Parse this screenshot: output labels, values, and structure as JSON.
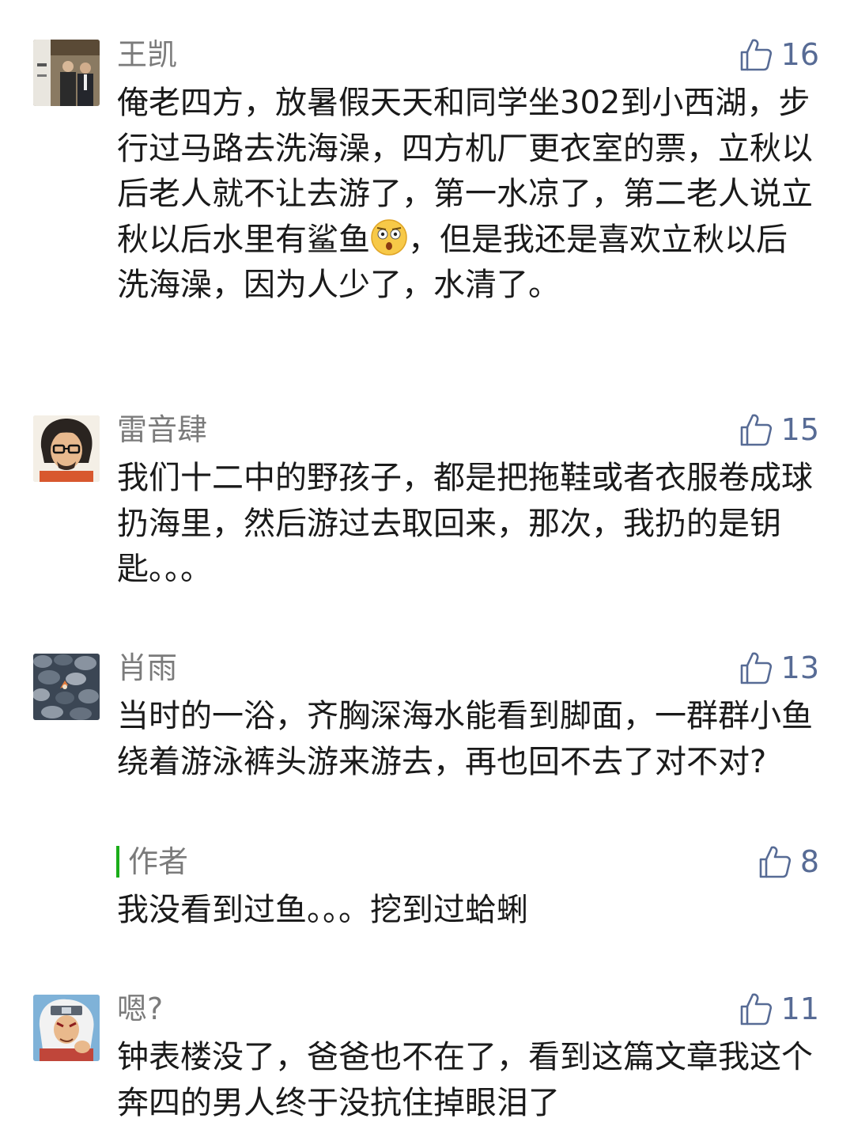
{
  "comments": [
    {
      "name": "王凯",
      "likes": "16",
      "text_before_emoji": "俺老四方，放暑假天天和同学坐302到小西湖，步行过马路去洗海澡，四方机厂更衣室的票，立秋以后老人就不让去游了，第一水凉了，第二老人说立秋以后水里有鲨鱼",
      "emoji": "shocked-face-emoji",
      "text_after_emoji": "，但是我还是喜欢立秋以后洗海澡，因为人少了，水清了。"
    },
    {
      "name": "雷音肆",
      "likes": "15",
      "text": "我们十二中的野孩子，都是把拖鞋或者衣服卷成球扔海里，然后游过去取回来，那次，我扔的是钥匙。。。"
    },
    {
      "name": "肖雨",
      "likes": "13",
      "text": "当时的一浴，齐胸深海水能看到脚面，一群群小鱼绕着游泳裤头游来游去，再也回不去了对不对?",
      "reply": {
        "name": "作者",
        "likes": "8",
        "text": "我没看到过鱼。。。挖到过蛤蜊"
      }
    },
    {
      "name": "嗯?",
      "likes": "11",
      "text": "钟表楼没了，爸爸也不在了，看到这篇文章我这个奔四的男人终于没抗住掉眼泪了"
    }
  ],
  "colors": {
    "name": "#7b7b7b",
    "like": "#576b95",
    "text": "#1a1a1a",
    "reply_bar": "#1aad19"
  },
  "icons": {
    "like": "thumbs-up-icon"
  }
}
